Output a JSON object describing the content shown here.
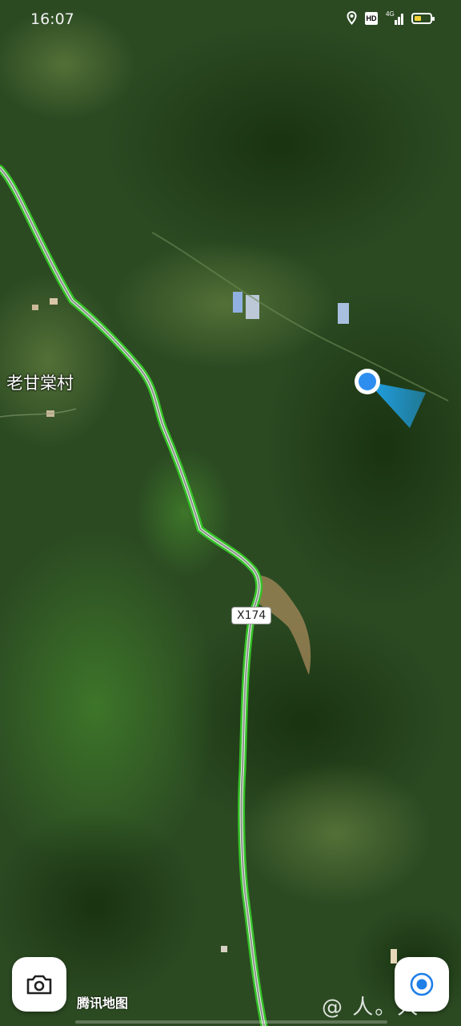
{
  "status_bar": {
    "time": "16:07",
    "network_label": "4G",
    "hd_label": "HD",
    "icons": [
      "location-icon",
      "hd-icon",
      "signal-icon",
      "battery-icon"
    ],
    "battery_level": 0.45
  },
  "map": {
    "village_label": "老甘棠村",
    "road_shield": "X174",
    "provider_logo": "腾讯地图",
    "watermark": "@ 人。人",
    "road_color": "#34c026",
    "location_color": "#2e8ef0",
    "heading_color": "#20a8f4"
  },
  "controls": {
    "camera_icon": "camera-icon",
    "locate_icon": "locate-me-icon",
    "accent": "#1f7fe8"
  }
}
